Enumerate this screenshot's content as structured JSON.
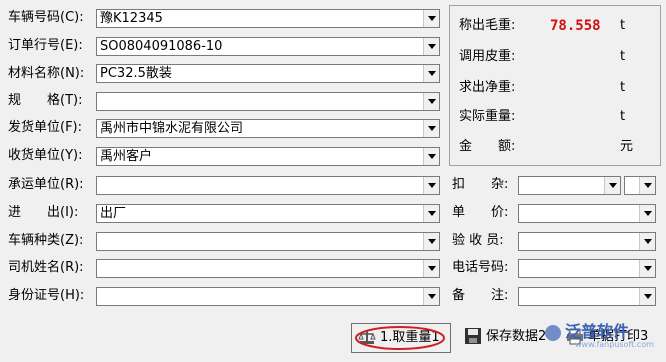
{
  "left_fields": [
    {
      "label": "车辆号码(C):",
      "value": "豫K12345"
    },
    {
      "label": "订单行号(E):",
      "value": "SO0804091086-10"
    },
    {
      "label": "材料名称(N):",
      "value": "PC32.5散装"
    },
    {
      "label": "规　　格(T):",
      "value": ""
    },
    {
      "label": "发货单位(F):",
      "value": "禹州市中锦水泥有限公司"
    },
    {
      "label": "收货单位(Y):",
      "value": "禹州客户"
    },
    {
      "label": "承运单位(R):",
      "value": ""
    },
    {
      "label": "进　　出(I):",
      "value": "出厂"
    },
    {
      "label": "车辆种类(Z):",
      "value": ""
    },
    {
      "label": "司机姓名(R):",
      "value": ""
    },
    {
      "label": "身份证号(H):",
      "value": ""
    }
  ],
  "weights": {
    "gross_label": "称出毛重:",
    "gross_value": "78.558",
    "gross_unit": "t",
    "tare_label": "调用皮重:",
    "tare_unit": "t",
    "net_label": "求出净重:",
    "net_unit": "t",
    "actual_label": "实际重量:",
    "actual_unit": "t",
    "amount_label": "金　　额:",
    "amount_unit": "元"
  },
  "right_fields": {
    "deduct_label": "扣　　杂:",
    "price_label": "单　　价:",
    "inspector_label": "验 收 员:",
    "phone_label": "电话号码:",
    "remark_label": "备　　注:"
  },
  "buttons": {
    "weigh": "1.取重量1",
    "save": "保存数据2",
    "print": "单据打印3"
  },
  "watermark": {
    "text": "泛普软件",
    "url": "www.fanpusoft.com"
  },
  "colors": {
    "weight_value": "#d01010",
    "highlight_ring": "#d02020"
  }
}
